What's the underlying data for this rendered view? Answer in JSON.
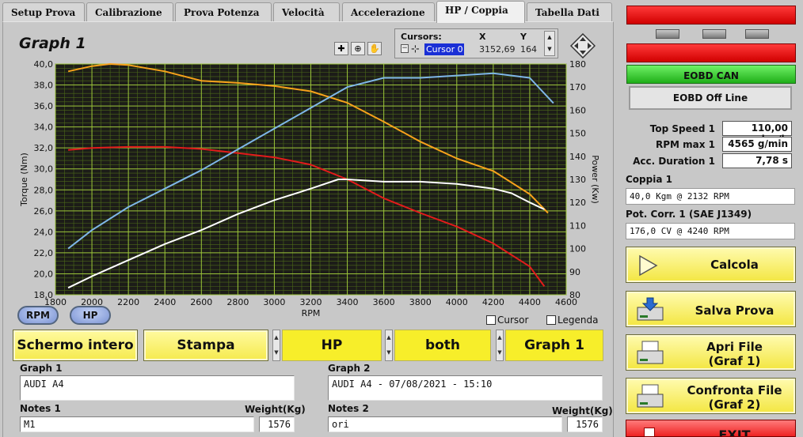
{
  "tabs": [
    "Setup Prova",
    "Calibrazione",
    "Prova Potenza",
    "Velocità",
    "Accelerazione",
    "HP / Coppia",
    "Tabella Dati"
  ],
  "graph_title": "Graph 1",
  "cursors": {
    "title": "Cursors:",
    "x_header": "X",
    "y_header": "Y",
    "name": "Cursor 0",
    "x": "3152,69",
    "y": "164"
  },
  "toolbar_icons": [
    "crosshair-zoom-icon",
    "magnifier-icon",
    "pan-hand-icon"
  ],
  "chart_data": {
    "type": "line",
    "xlabel": "RPM",
    "ylabel_left": "Torque (Nm)",
    "ylabel_right": "Power (Kw)",
    "xlim": [
      1800,
      4600
    ],
    "ylim_left": [
      18,
      40
    ],
    "ylim_right": [
      80,
      180
    ],
    "x_ticks": [
      "1800",
      "2000",
      "2200",
      "2400",
      "2600",
      "2800",
      "3000",
      "3200",
      "3400",
      "3600",
      "3800",
      "4000",
      "4200",
      "4400",
      "4600"
    ],
    "y_left_ticks": [
      "18,0",
      "20,0",
      "22,0",
      "24,0",
      "26,0",
      "28,0",
      "30,0",
      "32,0",
      "34,0",
      "36,0",
      "38,0",
      "40,0"
    ],
    "y_right_ticks": [
      "80",
      "90",
      "100",
      "110",
      "120",
      "130",
      "140",
      "150",
      "160",
      "170",
      "180"
    ],
    "grid": true,
    "background": "#1c1c18",
    "series": [
      {
        "axis": "left",
        "color": "#f7a21b",
        "x": [
          1870,
          2000,
          2100,
          2200,
          2400,
          2600,
          2800,
          3000,
          3200,
          3400,
          3600,
          3800,
          4000,
          4200,
          4400,
          4500
        ],
        "y": [
          39.3,
          39.8,
          40.0,
          39.9,
          39.3,
          38.4,
          38.2,
          37.9,
          37.4,
          36.3,
          34.5,
          32.6,
          31.0,
          29.8,
          27.6,
          25.8
        ]
      },
      {
        "axis": "left",
        "color": "#e31b1b",
        "x": [
          1870,
          2000,
          2200,
          2400,
          2600,
          2800,
          3000,
          3200,
          3400,
          3600,
          3800,
          4000,
          4200,
          4400,
          4480
        ],
        "y": [
          31.8,
          32.0,
          32.1,
          32.1,
          31.9,
          31.5,
          31.1,
          30.4,
          29.0,
          27.2,
          25.8,
          24.5,
          22.9,
          20.7,
          18.8
        ]
      },
      {
        "axis": "right",
        "color": "#7fb7e8",
        "x": [
          1870,
          2000,
          2200,
          2400,
          2600,
          2800,
          3000,
          3200,
          3400,
          3600,
          3800,
          4000,
          4200,
          4400,
          4530
        ],
        "y": [
          100,
          108,
          118,
          126,
          134,
          143,
          152,
          161,
          170,
          174,
          174,
          175,
          176,
          174,
          163
        ]
      },
      {
        "axis": "right",
        "color": "#ffffff",
        "x": [
          1870,
          2000,
          2200,
          2400,
          2600,
          2800,
          3000,
          3200,
          3350,
          3400,
          3600,
          3800,
          4000,
          4200,
          4300,
          4400,
          4480
        ],
        "y": [
          83,
          88,
          95,
          102,
          108,
          115,
          121,
          126,
          130,
          130,
          129,
          129,
          128,
          126,
          124,
          120,
          117
        ]
      }
    ]
  },
  "buttons": {
    "rpm": "RPM",
    "hp": "HP",
    "schermo": "Schermo intero",
    "stampa": "Stampa"
  },
  "checkboxes": {
    "cursor": "Cursor",
    "legenda": "Legenda"
  },
  "selectors": {
    "unit": "HP",
    "mode": "both",
    "graph": "Graph 1"
  },
  "graph1": {
    "label": "Graph 1",
    "value": "AUDI A4",
    "notes_label": "Notes 1",
    "notes": "M1",
    "weight_label": "Weight(Kg)",
    "weight": "1576"
  },
  "graph2": {
    "label": "Graph 2",
    "value": "AUDI A4  - 07/08/2021 - 15:10",
    "notes_label": "Notes 2",
    "notes": "ori",
    "weight_label": "Weight(Kg)",
    "weight": "1576"
  },
  "right_panel": {
    "eobd_can": "EOBD CAN",
    "eobd_offline": "EOBD Off Line",
    "top_speed_label": "Top Speed 1",
    "top_speed": "110,00 km/h",
    "rpm_max_label": "RPM max 1",
    "rpm_max": "4565 g/min",
    "acc_label": "Acc. Duration 1",
    "acc": "7,78 s",
    "coppia_label": "Coppia 1",
    "coppia": "40,0 Kgm  @ 2132  RPM",
    "pot_label": "Pot. Corr. 1 (SAE J1349)",
    "pot": "176,0 CV  @ 4240  RPM",
    "calcola": "Calcola",
    "salva": "Salva Prova",
    "apri_1": "Apri File",
    "apri_2": "(Graf 1)",
    "confronta_1": "Confronta File",
    "confronta_2": "(Graf 2)",
    "exit": "EXIT"
  },
  "colors": {
    "yellow": "#f7ee2a",
    "green": "#22c21c",
    "red": "#e60000"
  }
}
